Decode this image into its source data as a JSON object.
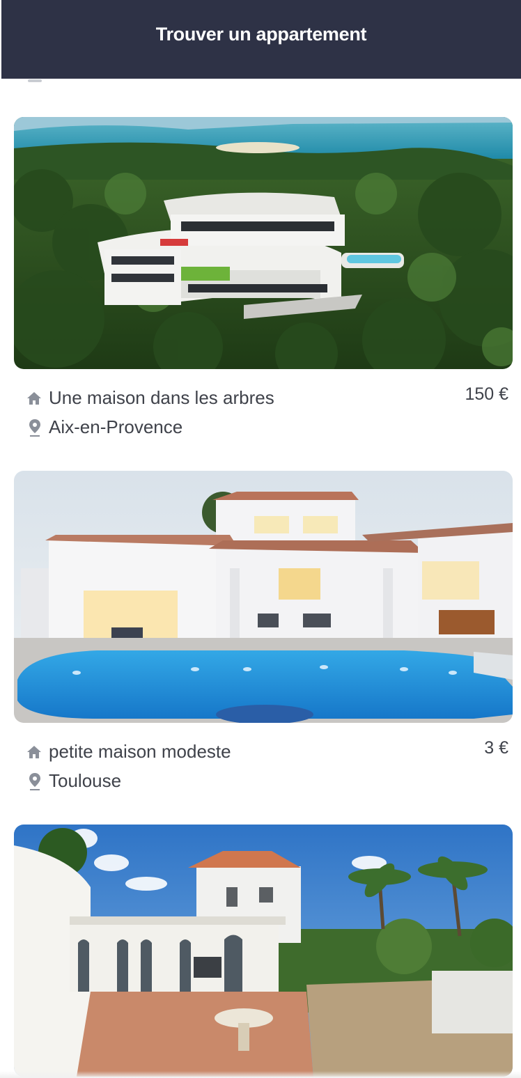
{
  "header": {
    "title": "Trouver un appartement"
  },
  "listings": [
    {
      "title": "Une maison dans les arbres",
      "city": "Aix-en-Provence",
      "price": "150 €",
      "photo_alt": "Villa blanche sur une colline boisée face à la mer"
    },
    {
      "title": "petite maison modeste",
      "city": "Toulouse",
      "price": "3 €",
      "photo_alt": "Maison blanche avec piscine au crépuscule"
    },
    {
      "title": "",
      "city": "",
      "price": "",
      "photo_alt": "Villa méditerranéenne avec palmiers et cour"
    }
  ],
  "icons": {
    "type": "home-icon",
    "location": "map-pin-icon"
  },
  "colors": {
    "header_bg": "#2e3246",
    "text": "#3f424a",
    "icon": "#8a8f99"
  }
}
